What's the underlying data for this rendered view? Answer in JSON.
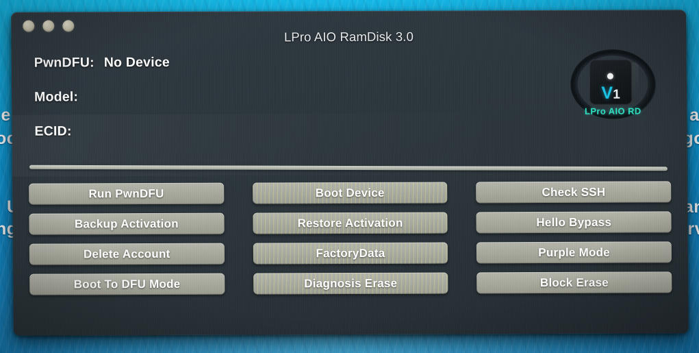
{
  "window": {
    "title": "LPro AIO RamDisk 3.0",
    "traffic_lights": [
      "close",
      "minimize",
      "zoom"
    ]
  },
  "status": {
    "rows": [
      {
        "label": "PwnDFU:",
        "value": "No Device"
      },
      {
        "label": "Model:",
        "value": ""
      },
      {
        "label": "ECID:",
        "value": ""
      }
    ]
  },
  "logo": {
    "mark": "V",
    "version": "1",
    "caption": "LPro AIO RD",
    "accent": "#19c3e6",
    "caption_color": "#2fe0c2"
  },
  "progress": {
    "value": 0,
    "label": ""
  },
  "buttons": [
    {
      "label": "Run PwnDFU",
      "shimmer": false
    },
    {
      "label": "Boot Device",
      "shimmer": true
    },
    {
      "label": "Check SSH",
      "shimmer": false
    },
    {
      "label": "Backup Activation",
      "shimmer": false
    },
    {
      "label": "Restore Activation",
      "shimmer": true
    },
    {
      "label": "Hello Bypass",
      "shimmer": false
    },
    {
      "label": "Delete Account",
      "shimmer": false
    },
    {
      "label": "FactoryData",
      "shimmer": true
    },
    {
      "label": "Purple Mode",
      "shimmer": false
    },
    {
      "label": "Boot To DFU Mode",
      "shimmer": false
    },
    {
      "label": "Diagnosis Erase",
      "shimmer": true
    },
    {
      "label": "Block Erase",
      "shimmer": false
    }
  ],
  "background": {
    "fragments_left": [
      "le",
      "oc",
      "U",
      "ng"
    ],
    "fragments_right": [
      "al",
      "go",
      "an",
      "erv"
    ]
  },
  "colors": {
    "window_bg": "#2c363d",
    "button_bg": "#a9aa9e",
    "text": "#ffffff",
    "desktop": "#0f9ad4"
  }
}
